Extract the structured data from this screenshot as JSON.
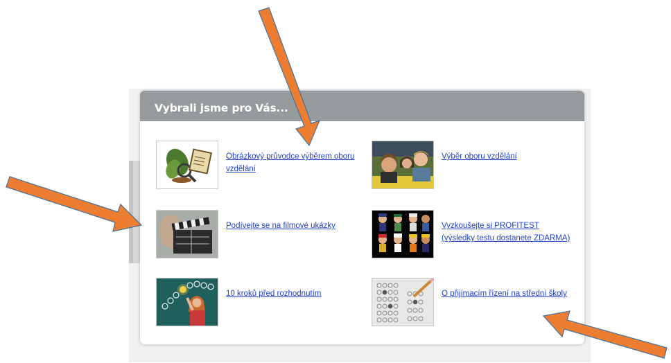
{
  "panel": {
    "title": "Vybrali jsme pro Vás..."
  },
  "items": [
    {
      "label": "Obrázkový průvodce výběrem oboru vzdělání",
      "icon": "leaves-scroll-illustration"
    },
    {
      "label": "Výběr oboru vzdělání",
      "icon": "students-photo"
    },
    {
      "label": "Podívejte se na filmové ukázky",
      "icon": "clapperboard-photo"
    },
    {
      "label": "Vyzkoušejte si PROFITEST (výsledky testu dostanete ZDARMA)",
      "icon": "professions-figures"
    },
    {
      "label": "10 kroků před rozhodnutím",
      "icon": "lightbulbs-woman-photo"
    },
    {
      "label": "O přijímacím řízení na střední školy",
      "icon": "answer-sheet-photo"
    }
  ],
  "colors": {
    "header": "#959a9c",
    "link": "#1e43c8",
    "arrow_fill": "#ed7d31",
    "arrow_stroke": "#41719c"
  }
}
